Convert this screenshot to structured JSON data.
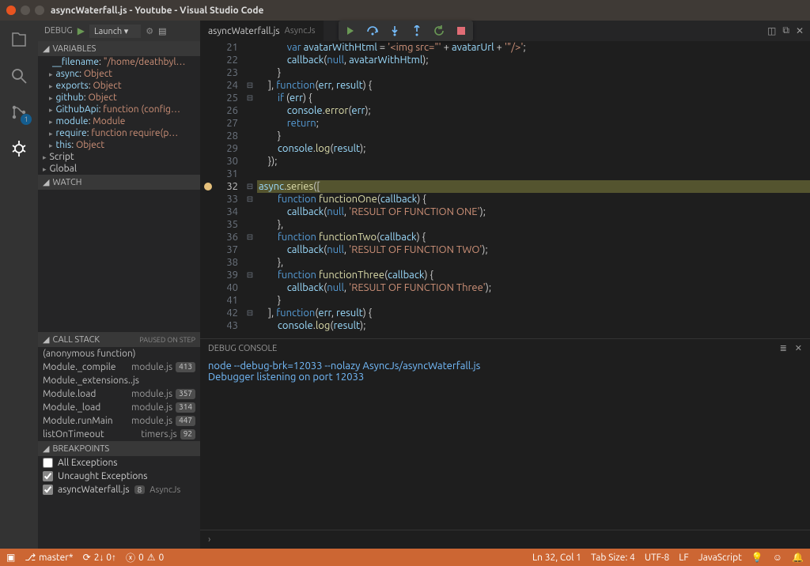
{
  "titlebar": {
    "title": "asyncWaterfall.js - Youtube - Visual Studio Code"
  },
  "sidebar": {
    "label": "DEBUG",
    "launch": "Launch",
    "badge": "1",
    "sections": {
      "variables": "VARIABLES",
      "watch": "WATCH",
      "callstack": "CALL STACK",
      "callstack_detail": "PAUSED ON STEP",
      "breakpoints": "BREAKPOINTS"
    },
    "vars": [
      {
        "name": "__filename",
        "value": "\"/home/deathbyl…",
        "cls": "k-str"
      },
      {
        "name": "async",
        "value": "Object",
        "cls": "k-type",
        "expandable": true
      },
      {
        "name": "exports",
        "value": "Object",
        "cls": "k-type",
        "expandable": true
      },
      {
        "name": "github",
        "value": "Object",
        "cls": "k-type",
        "expandable": true
      },
      {
        "name": "GithubApi",
        "value": "function (config…",
        "cls": "k-func",
        "expandable": true
      },
      {
        "name": "module",
        "value": "Module",
        "cls": "k-type",
        "expandable": true
      },
      {
        "name": "require",
        "value": "function require(p…",
        "cls": "k-func",
        "expandable": true
      },
      {
        "name": "this",
        "value": "Object",
        "cls": "k-type",
        "expandable": true
      }
    ],
    "scopes": [
      "Script",
      "Global"
    ],
    "stack": [
      {
        "fn": "(anonymous function)",
        "file": "",
        "line": ""
      },
      {
        "fn": "Module._compile",
        "file": "module.js",
        "line": "413"
      },
      {
        "fn": "Module._extensions..js",
        "file": "",
        "line": ""
      },
      {
        "fn": "Module.load",
        "file": "module.js",
        "line": "357"
      },
      {
        "fn": "Module._load",
        "file": "module.js",
        "line": "314"
      },
      {
        "fn": "Module.runMain",
        "file": "module.js",
        "line": "447"
      },
      {
        "fn": "listOnTimeout",
        "file": "timers.js",
        "line": "92"
      }
    ],
    "breakpoints": [
      {
        "checked": false,
        "label": "All Exceptions"
      },
      {
        "checked": true,
        "label": "Uncaught Exceptions"
      },
      {
        "checked": true,
        "label": "asyncWaterfall.js",
        "ln": "8",
        "grp": "AsyncJs"
      }
    ]
  },
  "editor": {
    "tab_name": "asyncWaterfall.js",
    "tab_desc": "AsyncJs",
    "first_line": 21,
    "current_line": 32,
    "folds": {
      "24": "⊟",
      "25": "⊟",
      "32": "⊟",
      "33": "⊟",
      "36": "⊟",
      "39": "⊟",
      "42": "⊟"
    },
    "lines": [
      "            var avatarWithHtml = '<img src=\"' + avatarUrl + '\"/>';",
      "            callback(null, avatarWithHtml);",
      "        }",
      "    ], function(err, result) {",
      "        if (err) {",
      "            console.error(err);",
      "            return;",
      "        }",
      "        console.log(result);",
      "    });",
      "",
      "async.series([",
      "        function functionOne(callback) {",
      "            callback(null, 'RESULT OF FUNCTION ONE');",
      "        },",
      "        function functionTwo(callback) {",
      "            callback(null, 'RESULT OF FUNCTION TWO');",
      "        },",
      "        function functionThree(callback) {",
      "            callback(null, 'RESULT OF FUNCTION Three');",
      "        }",
      "    ], function(err, result) {",
      "        console.log(result);"
    ]
  },
  "debug_console": {
    "title": "DEBUG CONSOLE",
    "cmd": "node --debug-brk=12033 --nolazy AsyncJs/asyncWaterfall.js",
    "info": "Debugger listening on port 12033"
  },
  "statusbar": {
    "branch": "master*",
    "sync": "2↓ 0↑",
    "errors": "0",
    "warnings": "0",
    "position": "Ln 32, Col 1",
    "tabsize": "Tab Size: 4",
    "encoding": "UTF-8",
    "eol": "LF",
    "lang": "JavaScript"
  }
}
